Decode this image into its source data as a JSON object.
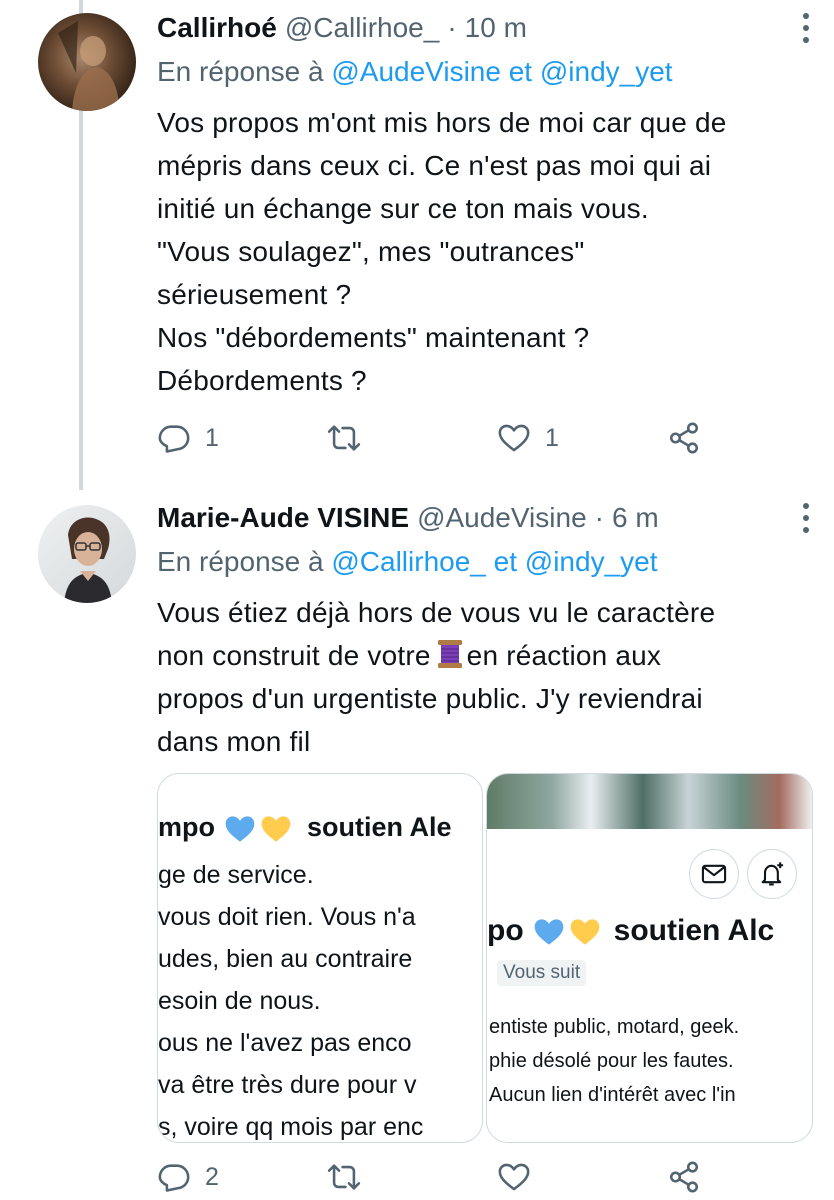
{
  "tweets": [
    {
      "name": "Callirhoé",
      "handle": "@Callirhoe_",
      "time": "10 m",
      "reply_prefix": "En réponse à",
      "reply_mentions": [
        "@AudeVisine",
        "@indy_yet"
      ],
      "reply_joiner": "et",
      "text_lines": [
        "Vos propos m'ont mis hors de moi car que de",
        "mépris dans ceux ci. Ce n'est pas moi qui ai",
        "initié un échange sur ce ton mais vous.",
        "\"Vous soulagez\", mes \"outrances\"",
        "sérieusement ?",
        "Nos \"débordements\" maintenant ?",
        "Débordements ?"
      ],
      "replies": "1",
      "retweets": "",
      "likes": "1"
    },
    {
      "name": "Marie-Aude VISINE",
      "handle": "@AudeVisine",
      "time": "6 m",
      "reply_prefix": "En réponse à",
      "reply_mentions": [
        "@Callirhoe_",
        "@indy_yet"
      ],
      "reply_joiner": "et",
      "text_lines": [
        "Vous étiez déjà hors de vous vu le caractère",
        "non construit de votre",
        "en réaction aux",
        "propos d'un urgentiste public. J'y reviendrai",
        "dans mon fil"
      ],
      "replies": "2",
      "retweets": "",
      "likes": "",
      "card_left": {
        "name": "mpo",
        "suffix": "soutien Ale",
        "bio_lines": [
          "ge de service.",
          "vous doit rien. Vous n'a",
          "udes, bien au contraire",
          "esoin de nous.",
          "ous ne l'avez pas enco",
          "va être très dure pour v",
          "s, voire qq mois par enc"
        ]
      },
      "card_right": {
        "name": "po",
        "suffix": "soutien Alc",
        "follows": "Vous suit",
        "bio_lines": [
          "entiste public, motard, geek.",
          "phie désolé pour les fautes.",
          "Aucun lien d'intérêt avec l'in"
        ]
      }
    }
  ],
  "icons": {
    "reply": "reply-icon",
    "retweet": "retweet-icon",
    "like": "heart-icon",
    "share": "share-icon",
    "more": "more-vertical-icon",
    "message": "envelope-icon",
    "notify": "bell-plus-icon",
    "spool": "thread-spool-emoji"
  },
  "colors": {
    "text": "#0f1419",
    "secondary": "#536471",
    "link": "#1d9bf0",
    "border": "#cfd9de",
    "thread_line": "#cfd9de"
  }
}
